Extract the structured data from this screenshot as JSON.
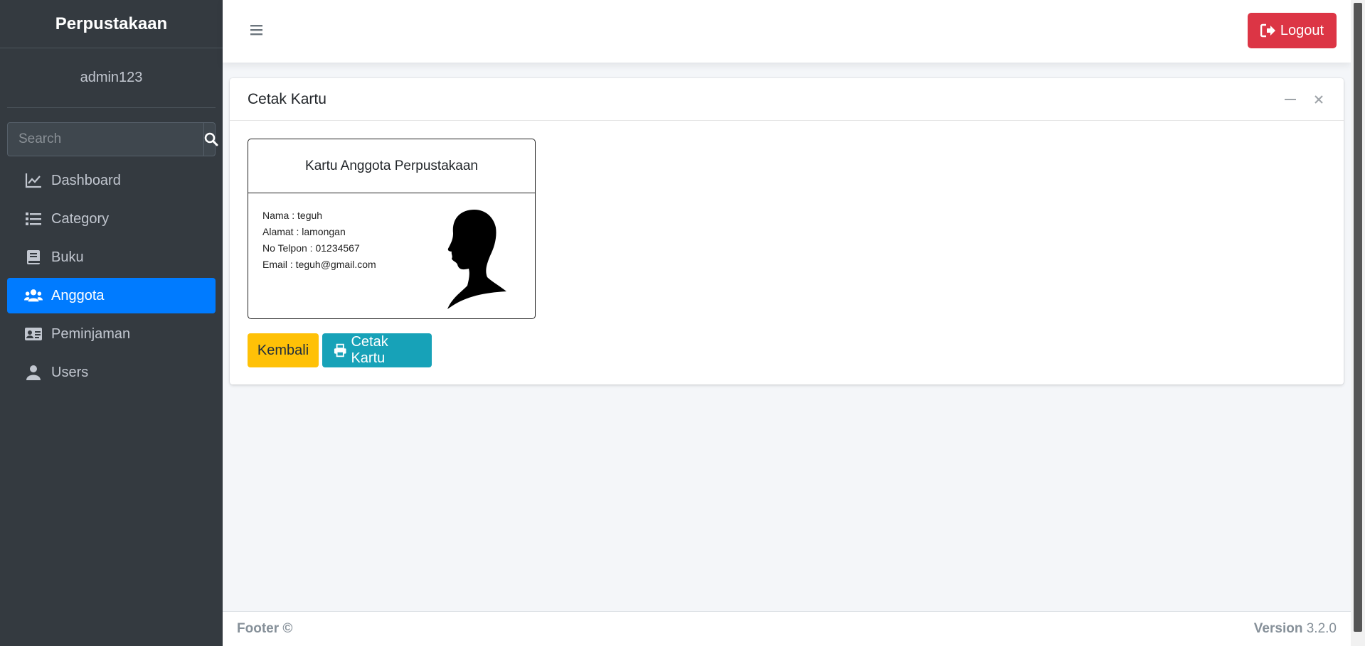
{
  "sidebar": {
    "brand": "Perpustakaan",
    "user": "admin123",
    "search_placeholder": "Search",
    "items": [
      {
        "label": "Dashboard",
        "icon": "chart-line-icon"
      },
      {
        "label": "Category",
        "icon": "list-icon"
      },
      {
        "label": "Buku",
        "icon": "book-icon"
      },
      {
        "label": "Anggota",
        "icon": "users-icon",
        "active": true
      },
      {
        "label": "Peminjaman",
        "icon": "id-card-icon"
      },
      {
        "label": "Users",
        "icon": "user-icon"
      }
    ]
  },
  "header": {
    "logout_label": "Logout"
  },
  "card": {
    "title": "Cetak Kartu",
    "member_card": {
      "heading": "Kartu Anggota Perpustakaan",
      "nama": "Nama : teguh",
      "alamat": "Alamat : lamongan",
      "telpon": "No Telpon : 01234567",
      "email": "Email : teguh@gmail.com"
    },
    "back_label": "Kembali",
    "print_label": "Cetak Kartu"
  },
  "footer": {
    "left": "Footer ©",
    "version_label": "Version",
    "version_number": "3.2.0"
  },
  "colors": {
    "sidebar_bg": "#343a40",
    "active": "#007bff",
    "logout": "#dc3545",
    "warning": "#ffc107",
    "info": "#17a2b8"
  }
}
